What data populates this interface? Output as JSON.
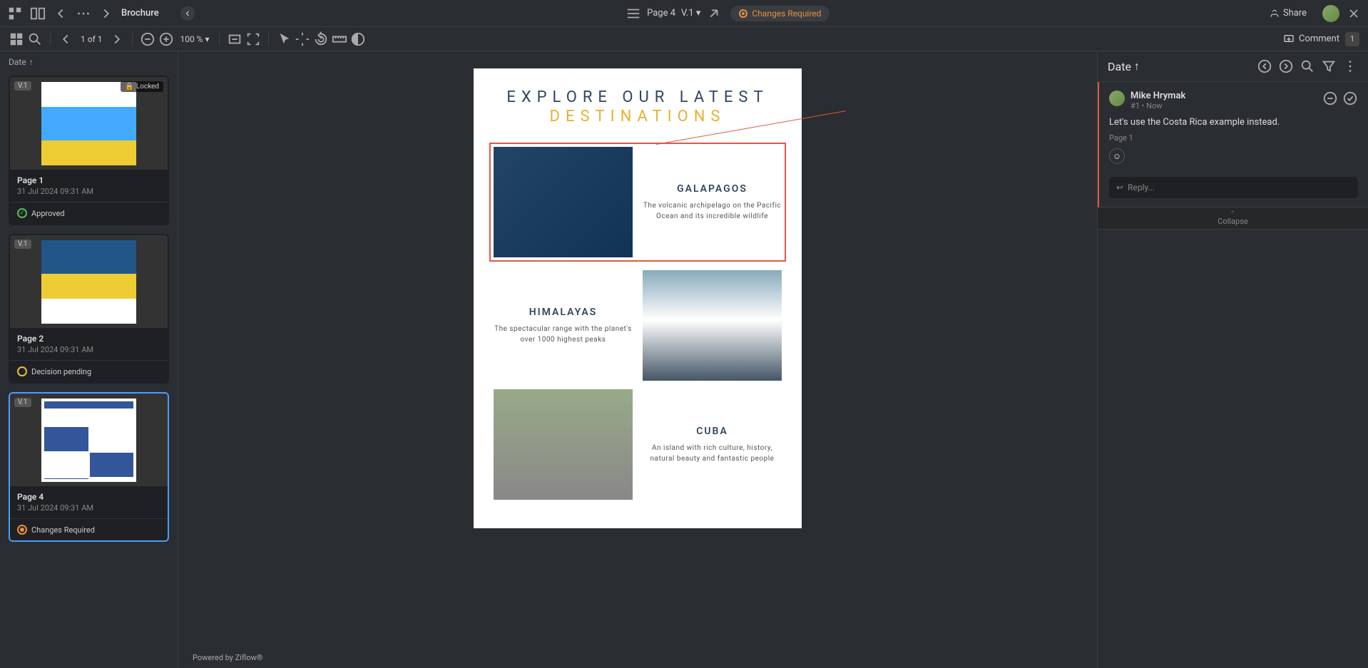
{
  "header": {
    "doc_title": "Brochure",
    "page_label": "Page 4",
    "version": "V.1",
    "status": "Changes Required",
    "share": "Share"
  },
  "toolbar": {
    "page_counter": "1 of 1",
    "zoom": "100 %",
    "comment_label": "Comment",
    "comment_count": "1"
  },
  "sidebar": {
    "sort_label": "Date",
    "thumbs": [
      {
        "version": "V.1",
        "locked": "Locked",
        "title": "Page 1",
        "date": "31 Jul 2024 09:31 AM",
        "status_label": "Approved",
        "status_type": "approved"
      },
      {
        "version": "V.1",
        "locked": "",
        "title": "Page 2",
        "date": "31 Jul 2024 09:31 AM",
        "status_label": "Decision pending",
        "status_type": "pending"
      },
      {
        "version": "V.1",
        "locked": "",
        "title": "Page 4",
        "date": "31 Jul 2024 09:31 AM",
        "status_label": "Changes Required",
        "status_type": "changes"
      }
    ]
  },
  "page_content": {
    "title1": "EXPLORE OUR LATEST",
    "title2": "DESTINATIONS",
    "dest": [
      {
        "name": "GALAPAGOS",
        "desc": "The volcanic archipelago on the Pacific Ocean and its incredible wildlife"
      },
      {
        "name": "HIMALAYAS",
        "desc": "The spectacular range with the planet's over 1000 highest peaks"
      },
      {
        "name": "CUBA",
        "desc": "An island with rich culture, history, natural beauty and fantastic people"
      }
    ]
  },
  "footer": "Powered by Ziflow®",
  "comments_panel": {
    "sort_label": "Date",
    "items": [
      {
        "author": "Mike Hrymak",
        "meta": "#1 • Now",
        "text": "Let's use the Costa Rica example instead.",
        "page_ref": "Page 1"
      }
    ],
    "reply_placeholder": "Reply...",
    "collapse": "Collapse"
  }
}
